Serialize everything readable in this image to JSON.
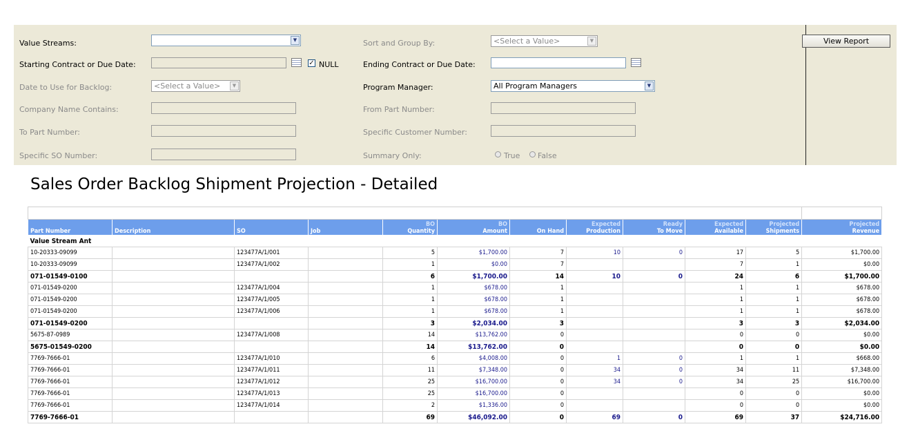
{
  "params": {
    "value_streams": {
      "label": "Value Streams:",
      "value": ""
    },
    "sort_group": {
      "label": "Sort and Group By:",
      "value": "<Select a Value>"
    },
    "starting_date": {
      "label": "Starting Contract or Due Date:",
      "value": "",
      "null_label": "NULL",
      "null_checked": true
    },
    "ending_date": {
      "label": "Ending Contract or Due Date:",
      "value": ""
    },
    "date_backlog": {
      "label": "Date to Use for Backlog:",
      "value": "<Select a Value>"
    },
    "program_manager": {
      "label": "Program Manager:",
      "value": "All Program Managers"
    },
    "company_name": {
      "label": "Company Name Contains:"
    },
    "from_part": {
      "label": "From Part Number:"
    },
    "to_part": {
      "label": "To Part Number:"
    },
    "customer_number": {
      "label": "Specific Customer Number:"
    },
    "so_number": {
      "label": "Specific SO Number:"
    },
    "summary_only": {
      "label": "Summary Only:",
      "true_label": "True",
      "false_label": "False"
    },
    "view_report": "View Report"
  },
  "report": {
    "title": "Sales Order Backlog Shipment Projection - Detailed",
    "columns": [
      {
        "l1": "",
        "l2": "Part Number",
        "align": "l"
      },
      {
        "l1": "",
        "l2": "Description",
        "align": "l"
      },
      {
        "l1": "",
        "l2": "SO",
        "align": "l"
      },
      {
        "l1": "",
        "l2": "Job",
        "align": "l"
      },
      {
        "l1": "BO",
        "l2": "Quantity",
        "align": "r"
      },
      {
        "l1": "BO",
        "l2": "Amount",
        "align": "r"
      },
      {
        "l1": "",
        "l2": "On Hand",
        "align": "r"
      },
      {
        "l1": "Expected",
        "l2": "Production",
        "align": "r"
      },
      {
        "l1": "Ready",
        "l2": "To Move",
        "align": "r"
      },
      {
        "l1": "Expected",
        "l2": "Available",
        "align": "r"
      },
      {
        "l1": "Projected",
        "l2": "Shipments",
        "align": "r"
      },
      {
        "l1": "Projected",
        "l2": "Revenue",
        "align": "r"
      }
    ],
    "group_label": "Value Stream  Ant",
    "rows": [
      {
        "type": "d",
        "part": "10-20333-09099",
        "desc": "",
        "so": "123477A/1/001",
        "job": "",
        "qty": "5",
        "amt": "$1,700.00",
        "onhand": "7",
        "prod": "10",
        "move": "0",
        "avail": "17",
        "ship": "5",
        "rev": "$1,700.00"
      },
      {
        "type": "d",
        "part": "10-20333-09099",
        "desc": "",
        "so": "123477A/1/002",
        "job": "",
        "qty": "1",
        "amt": "$0.00",
        "onhand": "7",
        "prod": "",
        "move": "",
        "avail": "7",
        "ship": "1",
        "rev": "$0.00"
      },
      {
        "type": "s",
        "part": "071-01549-0100",
        "desc": "",
        "so": "",
        "job": "",
        "qty": "6",
        "amt": "$1,700.00",
        "onhand": "14",
        "prod": "10",
        "move": "0",
        "avail": "24",
        "ship": "6",
        "rev": "$1,700.00"
      },
      {
        "type": "d",
        "part": "071-01549-0200",
        "desc": "",
        "so": "123477A/1/004",
        "job": "",
        "qty": "1",
        "amt": "$678.00",
        "onhand": "1",
        "prod": "",
        "move": "",
        "avail": "1",
        "ship": "1",
        "rev": "$678.00"
      },
      {
        "type": "d",
        "part": "071-01549-0200",
        "desc": "",
        "so": "123477A/1/005",
        "job": "",
        "qty": "1",
        "amt": "$678.00",
        "onhand": "1",
        "prod": "",
        "move": "",
        "avail": "1",
        "ship": "1",
        "rev": "$678.00"
      },
      {
        "type": "d",
        "part": "071-01549-0200",
        "desc": "",
        "so": "123477A/1/006",
        "job": "",
        "qty": "1",
        "amt": "$678.00",
        "onhand": "1",
        "prod": "",
        "move": "",
        "avail": "1",
        "ship": "1",
        "rev": "$678.00"
      },
      {
        "type": "s",
        "part": "071-01549-0200",
        "desc": "",
        "so": "",
        "job": "",
        "qty": "3",
        "amt": "$2,034.00",
        "onhand": "3",
        "prod": "",
        "move": "",
        "avail": "3",
        "ship": "3",
        "rev": "$2,034.00"
      },
      {
        "type": "d",
        "part": "5675-87-0989",
        "desc": "",
        "so": "123477A/1/008",
        "job": "",
        "qty": "14",
        "amt": "$13,762.00",
        "onhand": "0",
        "prod": "",
        "move": "",
        "avail": "0",
        "ship": "0",
        "rev": "$0.00"
      },
      {
        "type": "s",
        "part": "5675-01549-0200",
        "desc": "",
        "so": "",
        "job": "",
        "qty": "14",
        "amt": "$13,762.00",
        "onhand": "0",
        "prod": "",
        "move": "",
        "avail": "0",
        "ship": "0",
        "rev": "$0.00"
      },
      {
        "type": "d",
        "part": "7769-7666-01",
        "desc": "",
        "so": "123477A/1/010",
        "job": "",
        "qty": "6",
        "amt": "$4,008.00",
        "onhand": "0",
        "prod": "1",
        "move": "0",
        "avail": "1",
        "ship": "1",
        "rev": "$668.00"
      },
      {
        "type": "d",
        "part": "7769-7666-01",
        "desc": "",
        "so": "123477A/1/011",
        "job": "",
        "qty": "11",
        "amt": "$7,348.00",
        "onhand": "0",
        "prod": "34",
        "move": "0",
        "avail": "34",
        "ship": "11",
        "rev": "$7,348.00"
      },
      {
        "type": "d",
        "part": "7769-7666-01",
        "desc": "",
        "so": "123477A/1/012",
        "job": "",
        "qty": "25",
        "amt": "$16,700.00",
        "onhand": "0",
        "prod": "34",
        "move": "0",
        "avail": "34",
        "ship": "25",
        "rev": "$16,700.00"
      },
      {
        "type": "d",
        "part": "7769-7666-01",
        "desc": "",
        "so": "123477A/1/013",
        "job": "",
        "qty": "25",
        "amt": "$16,700.00",
        "onhand": "0",
        "prod": "",
        "move": "",
        "avail": "0",
        "ship": "0",
        "rev": "$0.00"
      },
      {
        "type": "d",
        "part": "7769-7666-01",
        "desc": "",
        "so": "123477A/1/014",
        "job": "",
        "qty": "2",
        "amt": "$1,336.00",
        "onhand": "0",
        "prod": "",
        "move": "",
        "avail": "0",
        "ship": "0",
        "rev": "$0.00"
      },
      {
        "type": "s",
        "part": "7769-7666-01",
        "desc": "",
        "so": "",
        "job": "",
        "qty": "69",
        "amt": "$46,092.00",
        "onhand": "0",
        "prod": "69",
        "move": "0",
        "avail": "69",
        "ship": "37",
        "rev": "$24,716.00"
      }
    ]
  }
}
